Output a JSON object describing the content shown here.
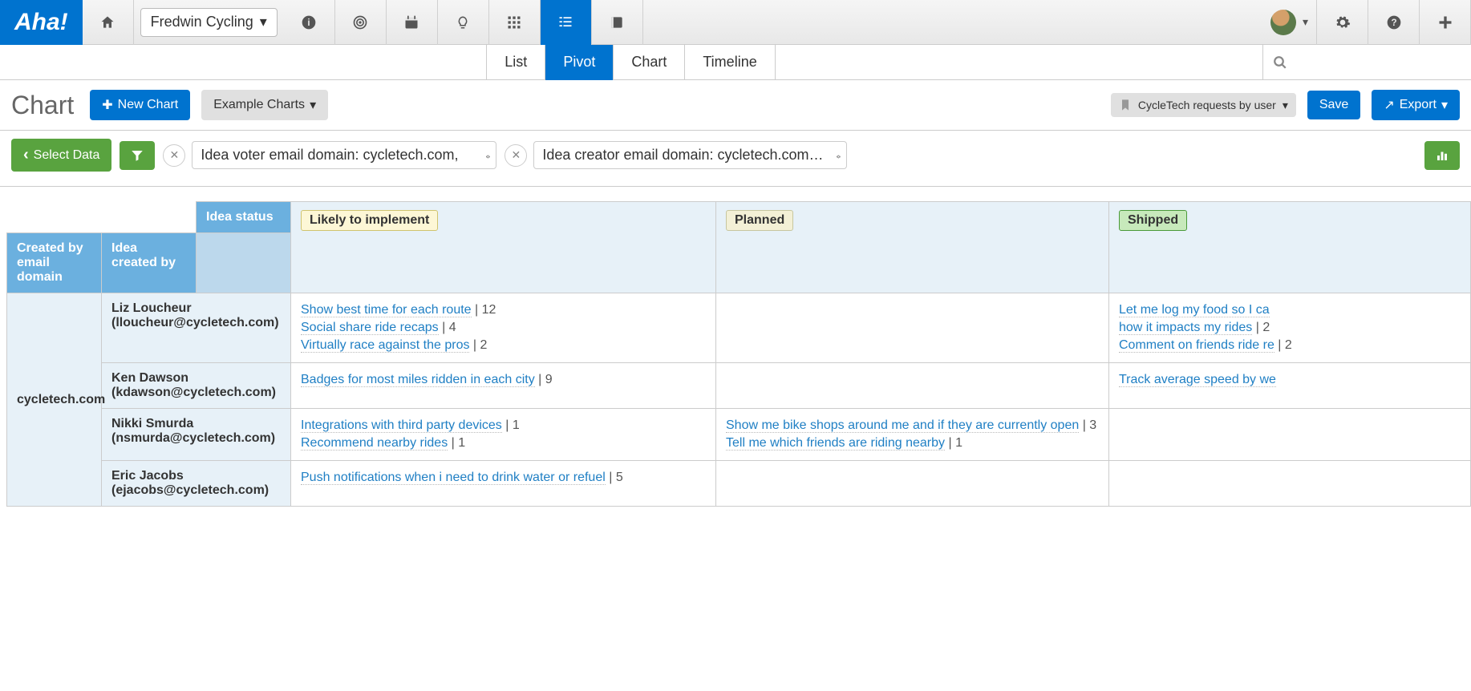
{
  "app": {
    "logo": "Aha!",
    "product": "Fredwin Cycling"
  },
  "tabs": {
    "list": "List",
    "pivot": "Pivot",
    "chart": "Chart",
    "timeline": "Timeline"
  },
  "toolbar": {
    "page_title": "Chart",
    "new_chart": "New Chart",
    "example_charts": "Example Charts",
    "bookmark_name": "CycleTech requests by user",
    "save": "Save",
    "export": "Export"
  },
  "filters": {
    "select_data": "Select Data",
    "pills": [
      "Idea voter email domain: cycletech.com,",
      "Idea creator email domain: cycletech.com…"
    ]
  },
  "pivot": {
    "col_header": "Idea status",
    "row_header1": "Created by email domain",
    "row_header2": "Idea created by",
    "statuses": [
      "Likely to implement",
      "Planned",
      "Shipped"
    ],
    "domain": "cycletech.com",
    "rows": [
      {
        "creator": "Liz Loucheur (lloucheur@cycletech.com)",
        "cells": [
          [
            {
              "t": "Show best time for each route",
              "c": 12
            },
            {
              "t": "Social share ride recaps",
              "c": 4
            },
            {
              "t": "Virtually race against the pros",
              "c": 2
            }
          ],
          [],
          [
            {
              "t": "Let me log my food so I ca",
              "tail": "how it impacts my rides",
              "c": 2
            },
            {
              "t": "Comment on friends ride re",
              "c": 2
            }
          ]
        ]
      },
      {
        "creator": "Ken Dawson (kdawson@cycletech.com)",
        "cells": [
          [
            {
              "t": "Badges for most miles ridden in each city",
              "c": 9
            }
          ],
          [],
          [
            {
              "t": "Track average speed by we"
            }
          ]
        ]
      },
      {
        "creator": "Nikki Smurda (nsmurda@cycletech.com)",
        "cells": [
          [
            {
              "t": "Integrations with third party devices",
              "c": 1
            },
            {
              "t": "Recommend nearby rides",
              "c": 1
            }
          ],
          [
            {
              "t": "Show me bike shops around me and if they are currently open",
              "c": 3
            },
            {
              "t": "Tell me which friends are riding nearby",
              "c": 1
            }
          ],
          []
        ]
      },
      {
        "creator": "Eric Jacobs (ejacobs@cycletech.com)",
        "cells": [
          [
            {
              "t": "Push notifications when i need to drink water or refuel",
              "c": 5
            }
          ],
          [],
          []
        ]
      }
    ]
  }
}
